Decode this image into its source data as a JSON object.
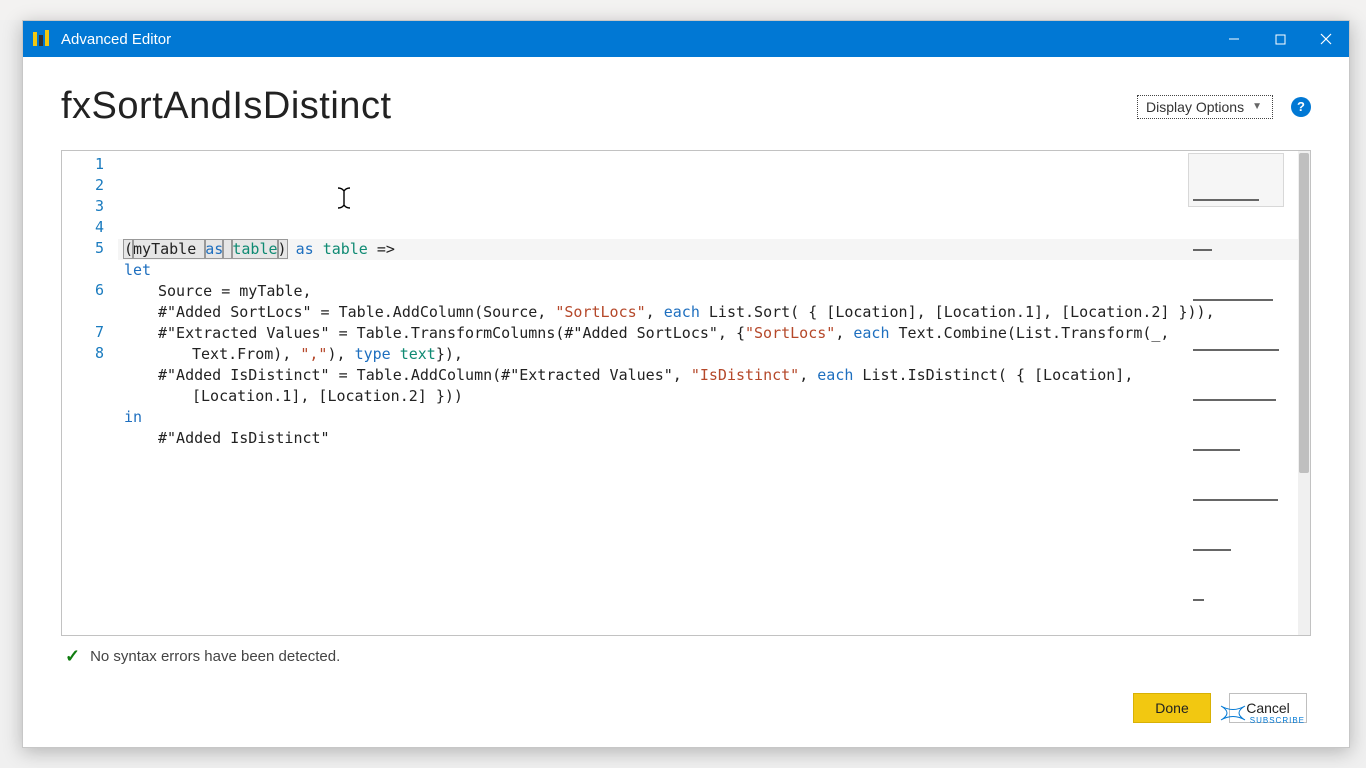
{
  "window": {
    "title": "Advanced Editor",
    "minimize_label": "Minimize",
    "maximize_label": "Maximize",
    "close_label": "Close"
  },
  "header": {
    "query_name": "fxSortAndIsDistinct",
    "display_options_label": "Display Options",
    "help_label": "?"
  },
  "editor": {
    "line_numbers": [
      "1",
      "2",
      "3",
      "4",
      "5",
      "6",
      "7",
      "8"
    ],
    "code_tokens": [
      [
        {
          "t": "(",
          "c": "txt",
          "hl": true
        },
        {
          "t": "myTable ",
          "c": "txt",
          "hl": true
        },
        {
          "t": "as",
          "c": "kw",
          "hl": true
        },
        {
          "t": " ",
          "c": "txt",
          "hl": true
        },
        {
          "t": "table",
          "c": "typ",
          "hl": true
        },
        {
          "t": ")",
          "c": "txt",
          "hl": true
        },
        {
          "t": " ",
          "c": "txt"
        },
        {
          "t": "as",
          "c": "kw"
        },
        {
          "t": " ",
          "c": "txt"
        },
        {
          "t": "table",
          "c": "typ"
        },
        {
          "t": " =>",
          "c": "txt"
        }
      ],
      [
        {
          "t": "let",
          "c": "kw"
        }
      ],
      [
        {
          "t": "Source = myTable,",
          "c": "txt"
        }
      ],
      [
        {
          "t": "#\"Added SortLocs\" = Table.AddColumn(Source, ",
          "c": "txt"
        },
        {
          "t": "\"SortLocs\"",
          "c": "str"
        },
        {
          "t": ", ",
          "c": "txt"
        },
        {
          "t": "each",
          "c": "kw"
        },
        {
          "t": " List.Sort( { [Location], [Location.1], [Location.2] })),",
          "c": "txt"
        }
      ],
      [
        {
          "t": "#\"Extracted Values\" = Table.TransformColumns(#\"Added SortLocs\", {",
          "c": "txt"
        },
        {
          "t": "\"SortLocs\"",
          "c": "str"
        },
        {
          "t": ", ",
          "c": "txt"
        },
        {
          "t": "each",
          "c": "kw"
        },
        {
          "t": " Text.Combine(List.Transform(_,",
          "c": "txt"
        }
      ],
      [
        {
          "t": "Text.From), ",
          "c": "txt"
        },
        {
          "t": "\",\"",
          "c": "str"
        },
        {
          "t": "), ",
          "c": "txt"
        },
        {
          "t": "type",
          "c": "kw"
        },
        {
          "t": " ",
          "c": "txt"
        },
        {
          "t": "text",
          "c": "typ"
        },
        {
          "t": "}),",
          "c": "txt"
        }
      ],
      [
        {
          "t": "#\"Added IsDistinct\" = Table.AddColumn(#\"Extracted Values\", ",
          "c": "txt"
        },
        {
          "t": "\"IsDistinct\"",
          "c": "str"
        },
        {
          "t": ", ",
          "c": "txt"
        },
        {
          "t": "each",
          "c": "kw"
        },
        {
          "t": " List.IsDistinct( { [Location],",
          "c": "txt"
        }
      ],
      [
        {
          "t": "[Location.1], [Location.2] }))",
          "c": "txt"
        }
      ],
      [
        {
          "t": "in",
          "c": "kw"
        }
      ],
      [
        {
          "t": "#\"Added IsDistinct\"",
          "c": "txt"
        }
      ]
    ],
    "line_indents": [
      0,
      0,
      1,
      1,
      1,
      2,
      1,
      2,
      0,
      1
    ],
    "physical_to_logical": [
      1,
      2,
      3,
      4,
      5,
      5,
      6,
      6,
      7,
      8
    ]
  },
  "status": {
    "message": "No syntax errors have been detected."
  },
  "buttons": {
    "done": "Done",
    "cancel": "Cancel"
  },
  "watermark": {
    "label": "SUBSCRIBE"
  }
}
